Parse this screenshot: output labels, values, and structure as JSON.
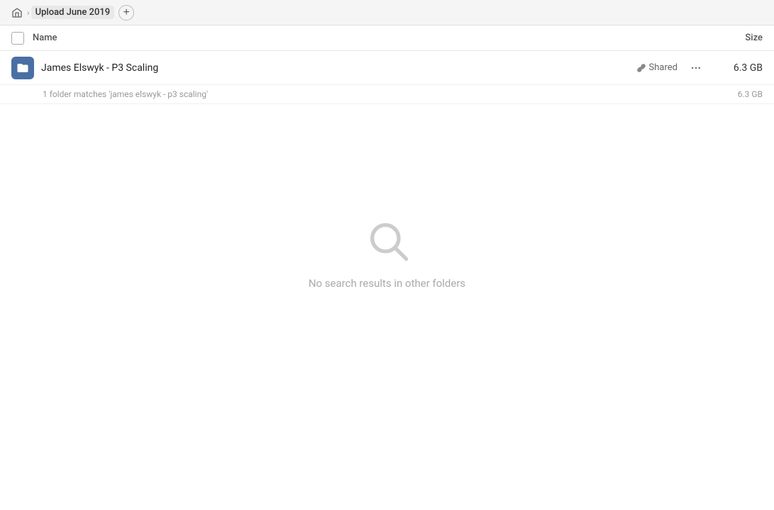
{
  "topbar": {
    "breadcrumb_label": "Upload June 2019",
    "add_tab_label": "+",
    "home_icon": "home"
  },
  "table_header": {
    "name_label": "Name",
    "size_label": "Size"
  },
  "file_row": {
    "name": "James Elswyk - P3 Scaling",
    "shared_label": "Shared",
    "more_label": "···",
    "size": "6.3 GB"
  },
  "match_line": {
    "text": "1 folder matches 'james elswyk - p3 scaling'",
    "size": "6.3 GB"
  },
  "empty_state": {
    "message": "No search results in other folders"
  }
}
